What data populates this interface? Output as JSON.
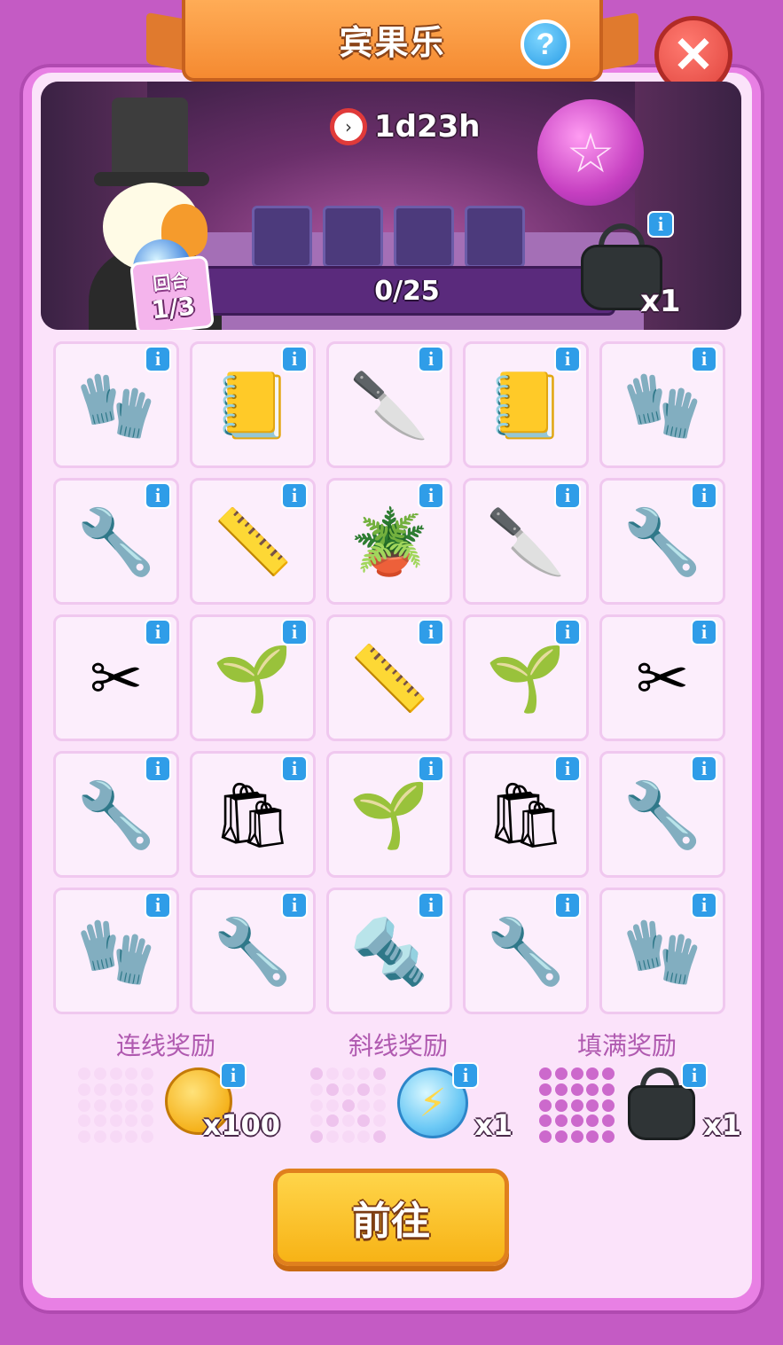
{
  "header": {
    "title": "宾果乐",
    "help_symbol": "?",
    "close_symbol": "✕"
  },
  "banner": {
    "timer": "1d23h",
    "round_label": "回合",
    "round_value": "1/3",
    "progress_text": "0/25",
    "progress_fraction": 0,
    "reward_count": "x1",
    "reward_icon": "tool-bag-icon"
  },
  "info_symbol": "i",
  "grid": [
    [
      "gloves-icon",
      "seed-packet-icon",
      "utility-knife-icon",
      "seed-packet-icon",
      "gloves-icon"
    ],
    [
      "wrench-icon",
      "tape-measure-icon",
      "potted-plant-icon",
      "utility-knife-icon",
      "wrench-icon"
    ],
    [
      "pliers-icon",
      "seedling-jar-icon",
      "tape-measure-icon",
      "seedling-jar-icon",
      "pliers-icon"
    ],
    [
      "wrench-icon",
      "soil-bag-icon",
      "seedling-jar-icon",
      "soil-bag-icon",
      "wrench-icon"
    ],
    [
      "gloves-icon",
      "wrench-icon",
      "pipe-wrench-icon",
      "wrench-icon",
      "gloves-icon"
    ]
  ],
  "rewards": [
    {
      "title": "连线奖励",
      "icon": "coin-icon",
      "count": "x100"
    },
    {
      "title": "斜线奖励",
      "icon": "energy-orb-icon",
      "count": "x1"
    },
    {
      "title": "填满奖励",
      "icon": "tool-bag-icon",
      "count": "x1"
    }
  ],
  "go_button": "前往"
}
